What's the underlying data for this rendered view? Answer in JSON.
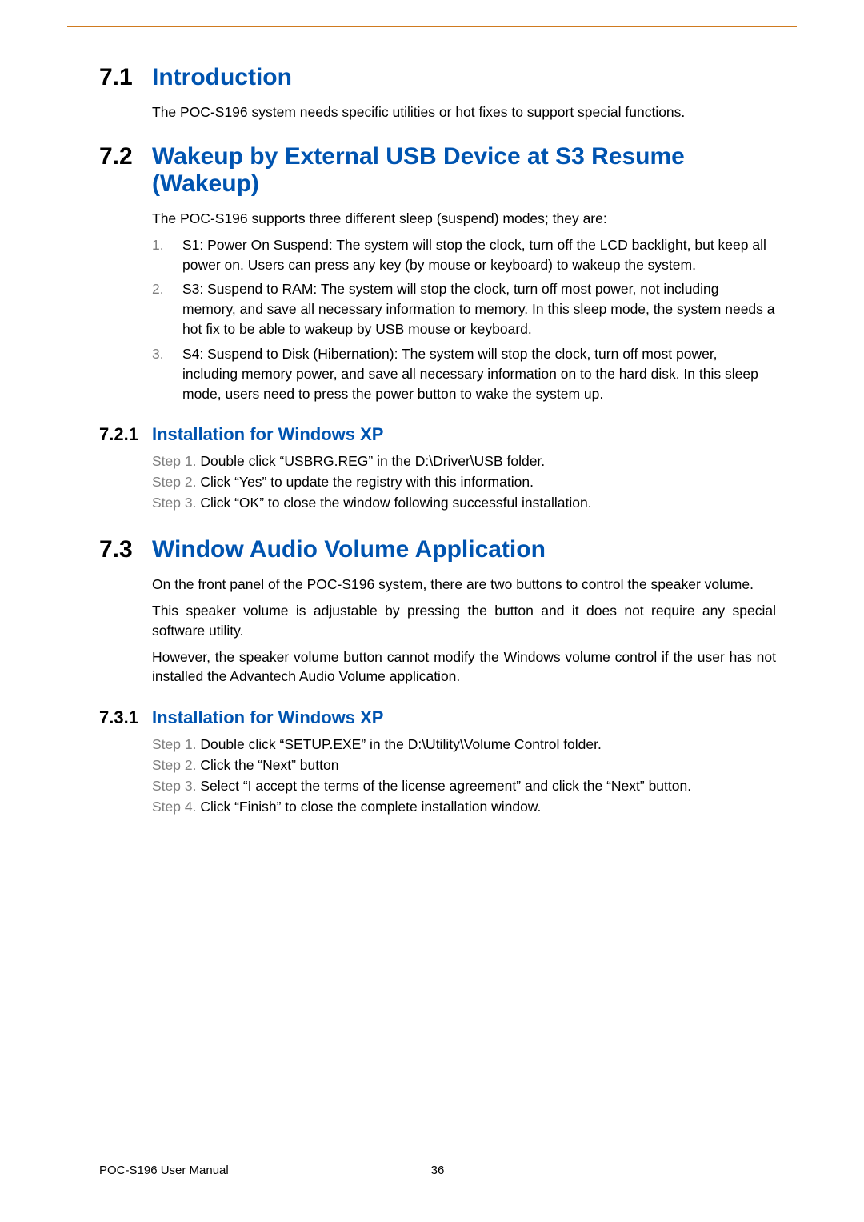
{
  "sections": {
    "s71": {
      "num": "7.1",
      "title": "Introduction",
      "body": "The POC-S196 system needs specific utilities or hot fixes to support special functions."
    },
    "s72": {
      "num": "7.2",
      "title_l1": "Wakeup by External USB Device at S3 Resume",
      "title_l2": "(Wakeup)",
      "intro": "The POC-S196 supports three different sleep (suspend) modes; they are:",
      "items": [
        {
          "n": "1.",
          "t": "S1: Power On Suspend: The system will stop the clock, turn off the LCD backlight, but keep all power on. Users can press any key (by mouse or keyboard) to wakeup the system."
        },
        {
          "n": "2.",
          "t": "S3: Suspend to RAM: The system will stop the clock, turn off most power, not including memory, and save all necessary information to memory. In this sleep mode, the system needs a hot fix to be able to wakeup by USB mouse or keyboard."
        },
        {
          "n": "3.",
          "t": "S4: Suspend to Disk (Hibernation): The system will stop the clock, turn off most power, including memory power, and save all necessary information on to the hard disk. In this sleep mode, users need to press the power button to wake the system up."
        }
      ]
    },
    "s721": {
      "num": "7.2.1",
      "title": "Installation for Windows XP",
      "steps": [
        {
          "lab": "Step 1. ",
          "t": "Double click “USBRG.REG” in the D:\\Driver\\USB folder."
        },
        {
          "lab": "Step 2. ",
          "t": "Click “Yes” to update the registry with this information."
        },
        {
          "lab": "Step 3. ",
          "t": "Click “OK” to close the window following successful installation."
        }
      ]
    },
    "s73": {
      "num": "7.3",
      "title": "Window Audio Volume Application",
      "p1": "On the front panel of the POC-S196 system, there are two buttons to control the speaker volume.",
      "p2": "This speaker volume is adjustable by pressing the button and it does not require any special software utility.",
      "p3": "However, the speaker volume button cannot modify the Windows volume control if the user has not installed the Advantech Audio Volume application."
    },
    "s731": {
      "num": "7.3.1",
      "title": "Installation for Windows XP",
      "steps": [
        {
          "lab": "Step 1. ",
          "t": "Double click “SETUP.EXE” in the D:\\Utility\\Volume Control folder."
        },
        {
          "lab": "Step 2. ",
          "t": "Click the “Next” button"
        },
        {
          "lab": "Step 3. ",
          "t": "Select “I accept the terms of the license agreement” and click the “Next” button."
        },
        {
          "lab": "Step 4. ",
          "t": "Click “Finish” to close the complete installation window."
        }
      ]
    }
  },
  "footer": {
    "left": "POC-S196 User Manual",
    "page": "36"
  }
}
